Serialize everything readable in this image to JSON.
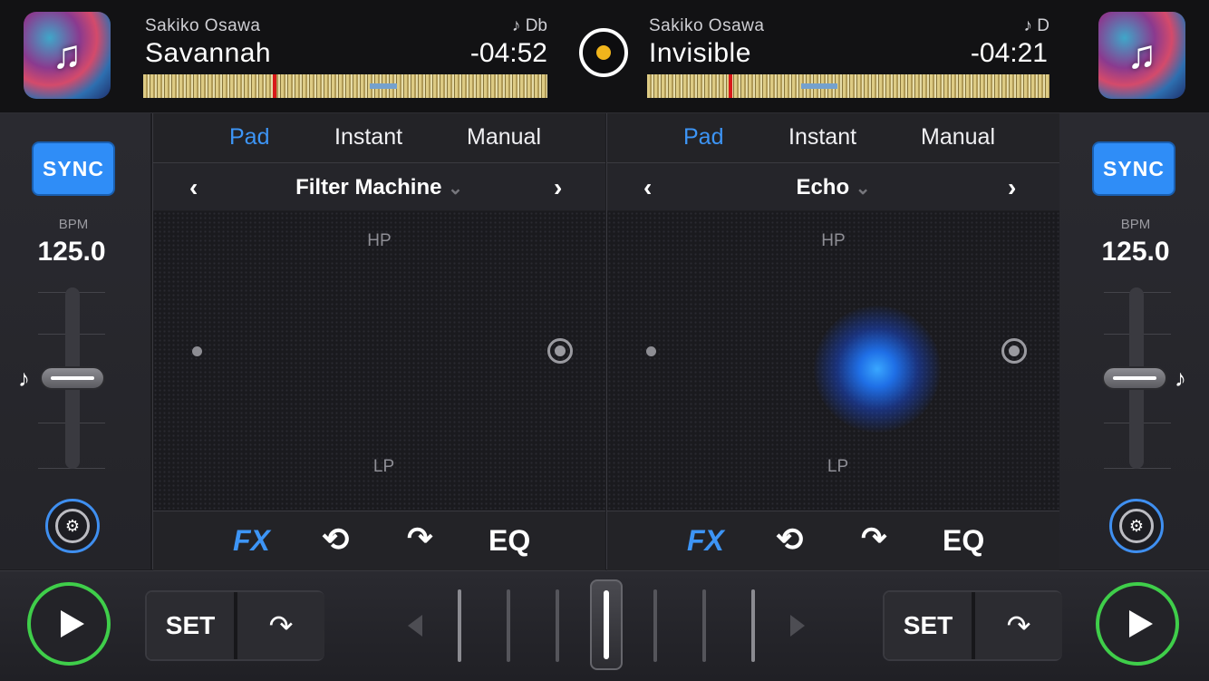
{
  "deckA": {
    "artist": "Sakiko Osawa",
    "title": "Savannah",
    "key": "♪ Db",
    "time": "-04:52",
    "art_icon": "♫",
    "sync_label": "SYNC",
    "bpm_label": "BPM",
    "bpm": "125.0",
    "tabs": [
      "Pad",
      "Instant",
      "Manual"
    ],
    "active_tab": "Pad",
    "effect": "Filter Machine",
    "hp_label": "HP",
    "lp_label": "LP",
    "bottom_tabs": [
      "FX",
      "EQ"
    ],
    "set_label": "SET"
  },
  "deckB": {
    "artist": "Sakiko Osawa",
    "title": "Invisible",
    "key": "♪ D",
    "time": "-04:21",
    "art_icon": "♫",
    "sync_label": "SYNC",
    "bpm_label": "BPM",
    "bpm": "125.0",
    "tabs": [
      "Pad",
      "Instant",
      "Manual"
    ],
    "active_tab": "Pad",
    "effect": "Echo",
    "hp_label": "HP",
    "lp_label": "LP",
    "bottom_tabs": [
      "FX",
      "EQ"
    ],
    "set_label": "SET"
  },
  "icons": {
    "prev": "‹",
    "next": "›",
    "dropdown": "⌄",
    "pitch_note": "♪",
    "loop": "⟲",
    "cue": "↷"
  },
  "colors": {
    "accent": "#2f8df7",
    "play_ring": "#3fce4a",
    "playhead": "#e31b1b",
    "record": "#f1b51c"
  }
}
